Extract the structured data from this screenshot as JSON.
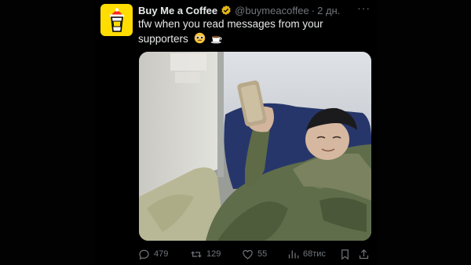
{
  "tweet": {
    "author_name": "Buy Me a Coffee",
    "handle": "@buymeacoffee",
    "separator": "·",
    "date": "2 дн.",
    "more": "···",
    "text": "tfw when you read messages from your supporters",
    "emojis": [
      "pleading-face",
      "hot-beverage"
    ]
  },
  "actions": {
    "replies": "479",
    "retweets": "129",
    "likes": "55",
    "views": "68тис"
  },
  "colors": {
    "background": "#000000",
    "text": "#e7e9ea",
    "muted": "#71767b",
    "avatar_bg": "#ffdd00",
    "verified": "#e2b719"
  }
}
